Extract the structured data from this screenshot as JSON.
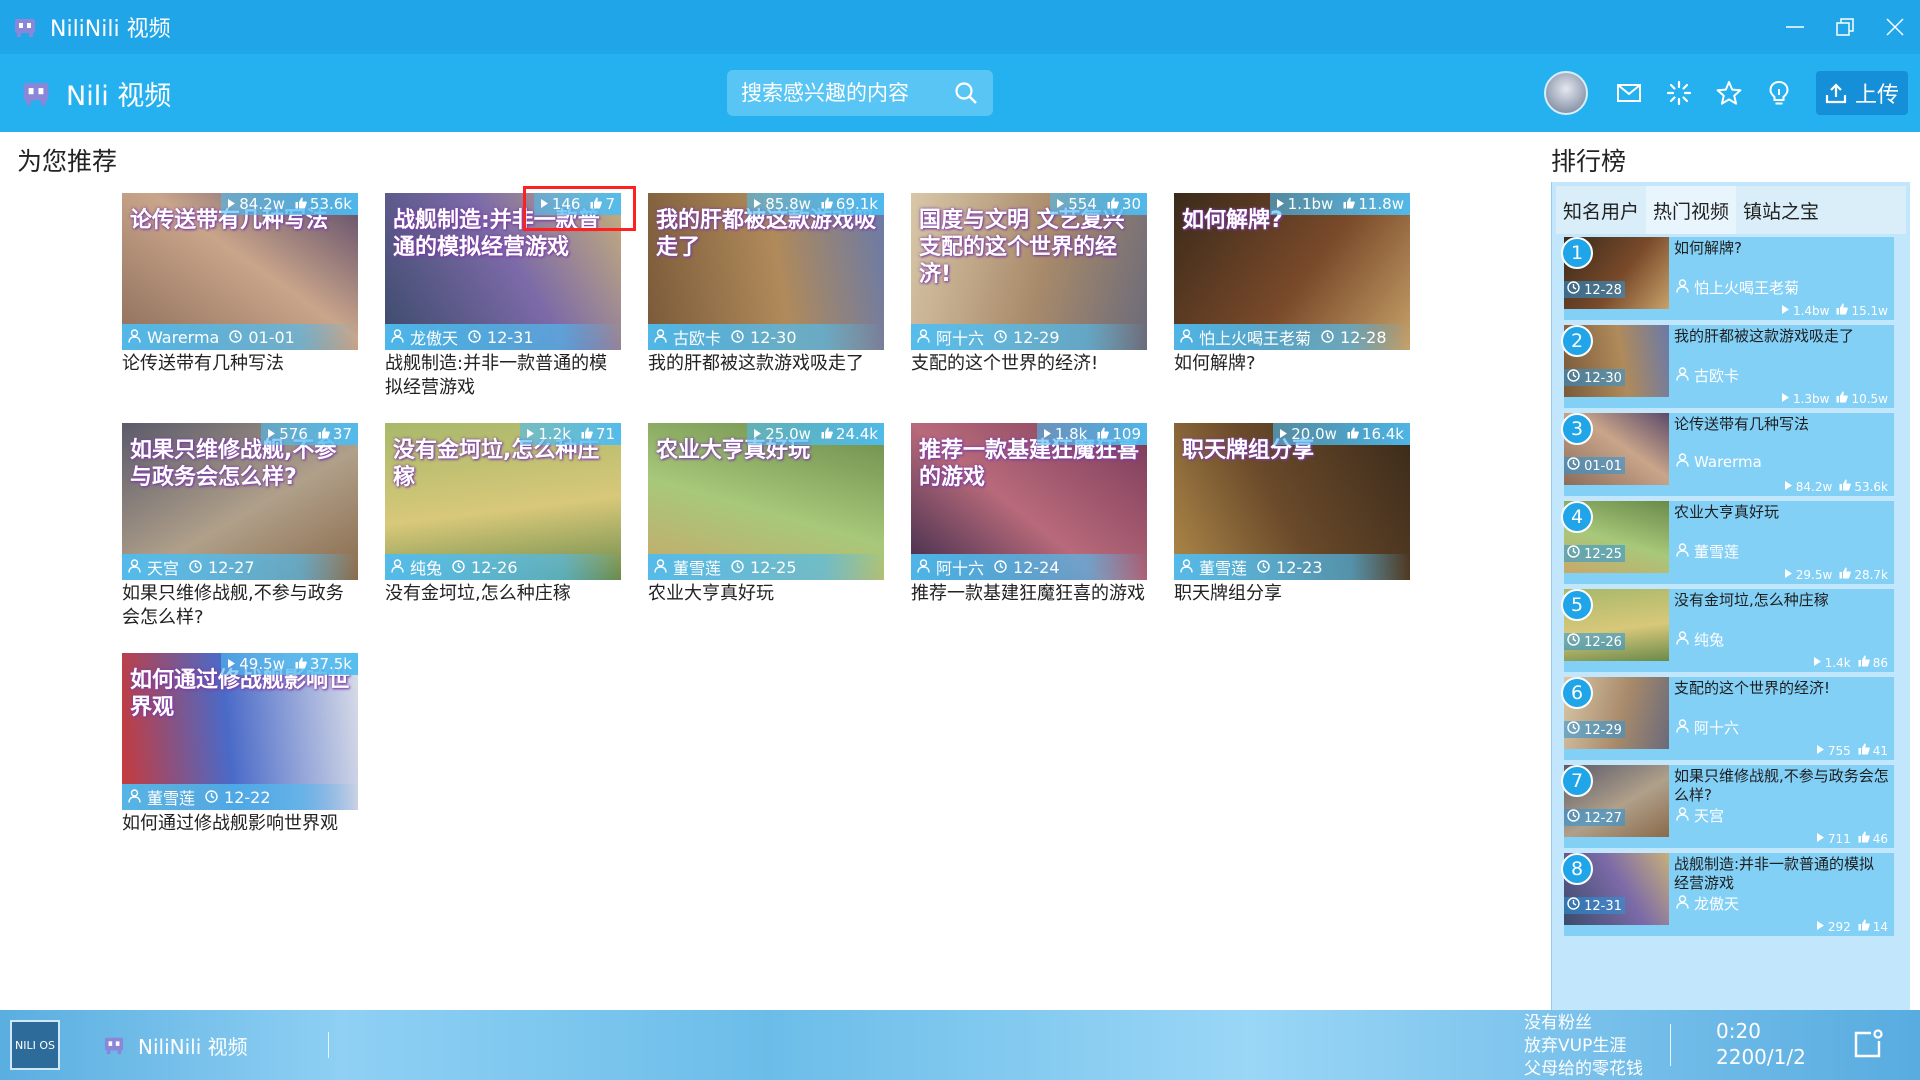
{
  "window": {
    "title": "NiliNili 视频"
  },
  "header": {
    "app_name": "Nili 视频",
    "search_placeholder": "搜索感兴趣的内容",
    "upload_label": "上传"
  },
  "main": {
    "section_title": "为您推荐",
    "videos": [
      {
        "title": "论传送带有几种写法",
        "overlay": "论传送带有几种写法",
        "views": "84.2w",
        "likes": "53.6k",
        "author": "Warerma",
        "date": "01-01"
      },
      {
        "title": "战舰制造:并非一款普通的模拟经营游戏",
        "overlay": "战舰制造:并非一款普通的模拟经营游戏",
        "views": "146",
        "likes": "7",
        "author": "龙傲天",
        "date": "12-31"
      },
      {
        "title": "我的肝都被这款游戏吸走了",
        "overlay": "我的肝都被这款游戏吸走了",
        "views": "85.8w",
        "likes": "69.1k",
        "author": "古欧卡",
        "date": "12-30"
      },
      {
        "title": "支配的这个世界的经济!",
        "overlay": "国度与文明 文艺复兴 支配的这个世界的经济!",
        "views": "554",
        "likes": "30",
        "author": "阿十六",
        "date": "12-29"
      },
      {
        "title": "如何解牌?",
        "overlay": "如何解牌?",
        "views": "1.1bw",
        "likes": "11.8w",
        "author": "怕上火喝王老菊",
        "date": "12-28"
      },
      {
        "title": "如果只维修战舰,不参与政务会怎么样?",
        "overlay": "如果只维修战舰,不参与政务会怎么样?",
        "views": "576",
        "likes": "37",
        "author": "天宫",
        "date": "12-27"
      },
      {
        "title": "没有金坷垃,怎么种庄稼",
        "overlay": "没有金坷垃,怎么种庄稼",
        "views": "1.2k",
        "likes": "71",
        "author": "纯兔",
        "date": "12-26"
      },
      {
        "title": "农业大亨真好玩",
        "overlay": "农业大亨真好玩",
        "views": "25.0w",
        "likes": "24.4k",
        "author": "董雪莲",
        "date": "12-25"
      },
      {
        "title": "推荐一款基建狂魔狂喜的游戏",
        "overlay": "推荐一款基建狂魔狂喜的游戏",
        "views": "1.8k",
        "likes": "109",
        "author": "阿十六",
        "date": "12-24"
      },
      {
        "title": "职天牌组分享",
        "overlay": "职天牌组分享",
        "views": "20.0w",
        "likes": "16.4k",
        "author": "董雪莲",
        "date": "12-23"
      },
      {
        "title": "如何通过修战舰影响世界观",
        "overlay": "如何通过修战舰影响世界观",
        "views": "49.5w",
        "likes": "37.5k",
        "author": "董雪莲",
        "date": "12-22"
      }
    ]
  },
  "ranking": {
    "title": "排行榜",
    "tabs": [
      "知名用户",
      "热门视频",
      "镇站之宝"
    ],
    "active_tab": "热门视频",
    "items": [
      {
        "rank": "1",
        "title": "如何解牌?",
        "author": "怕上火喝王老菊",
        "date": "12-28",
        "views": "1.4bw",
        "likes": "15.1w"
      },
      {
        "rank": "2",
        "title": "我的肝都被这款游戏吸走了",
        "author": "古欧卡",
        "date": "12-30",
        "views": "1.3bw",
        "likes": "10.5w"
      },
      {
        "rank": "3",
        "title": "论传送带有几种写法",
        "author": "Warerma",
        "date": "01-01",
        "views": "84.2w",
        "likes": "53.6k"
      },
      {
        "rank": "4",
        "title": "农业大亨真好玩",
        "author": "董雪莲",
        "date": "12-25",
        "views": "29.5w",
        "likes": "28.7k"
      },
      {
        "rank": "5",
        "title": "没有金坷垃,怎么种庄稼",
        "author": "纯兔",
        "date": "12-26",
        "views": "1.4k",
        "likes": "86"
      },
      {
        "rank": "6",
        "title": "支配的这个世界的经济!",
        "author": "阿十六",
        "date": "12-29",
        "views": "755",
        "likes": "41"
      },
      {
        "rank": "7",
        "title": "如果只维修战舰,不参与政务会怎么样?",
        "author": "天宫",
        "date": "12-27",
        "views": "711",
        "likes": "46"
      },
      {
        "rank": "8",
        "title": "战舰制造:并非一款普通的模拟经营游戏",
        "author": "龙傲天",
        "date": "12-31",
        "views": "292",
        "likes": "14"
      }
    ]
  },
  "taskbar": {
    "start_label": "NILI OS",
    "app_label": "NiliNili 视频",
    "tray_lines": [
      "没有粉丝",
      "放弃VUP生涯",
      "父母给的零花钱"
    ],
    "clock_time": "0:20",
    "clock_date": "2200/1/2"
  },
  "colors": {
    "titlebar": "#1fa5e8",
    "header": "#25b0f0",
    "accent": "#4fbcf0",
    "rank_panel": "#c2e6fb",
    "highlight": "#ff2020"
  }
}
